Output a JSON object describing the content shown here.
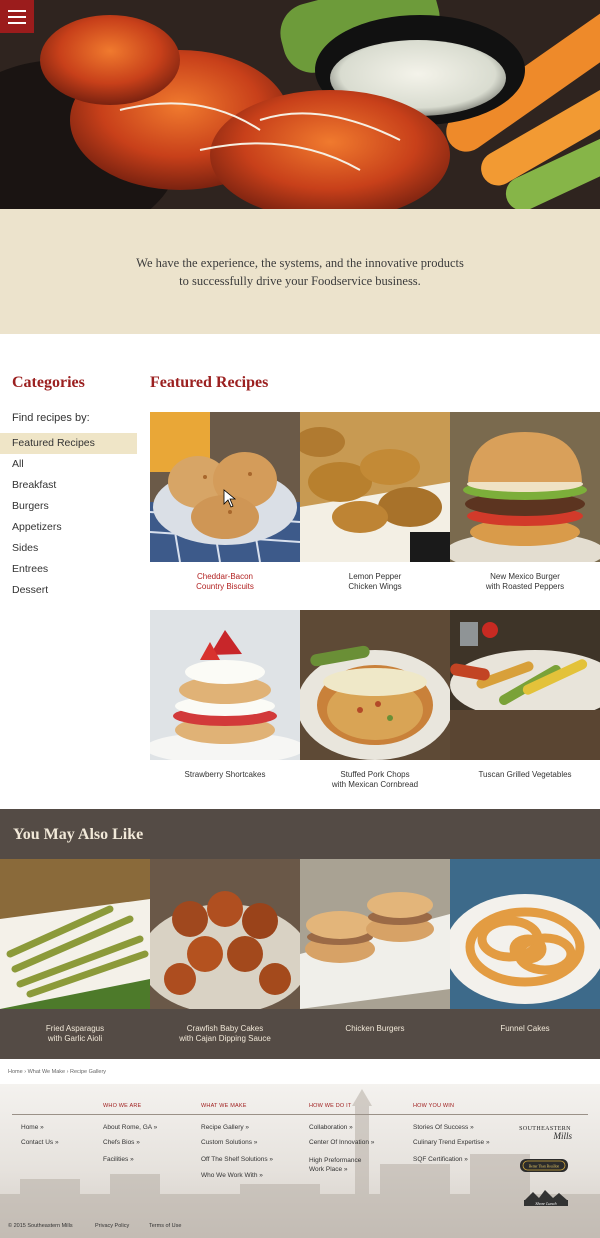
{
  "tagline": {
    "line1": "We have the experience, the systems, and the innovative products",
    "line2": "to successfully drive your Foodservice business."
  },
  "categories": {
    "title": "Categories",
    "find_label": "Find recipes by:",
    "items": [
      "Featured Recipes",
      "All",
      "Breakfast",
      "Burgers",
      "Appetizers",
      "Sides",
      "Entrees",
      "Dessert"
    ],
    "active_index": 0
  },
  "featured": {
    "title": "Featured Recipes",
    "recipes": [
      {
        "caption": "Cheddar-Bacon\nCountry Biscuits"
      },
      {
        "caption": "Lemon Pepper\nChicken Wings"
      },
      {
        "caption": "New Mexico Burger\nwith Roasted Peppers"
      },
      {
        "caption": "Strawberry Shortcakes"
      },
      {
        "caption": "Stuffed Pork Chops\nwith Mexican Cornbread"
      },
      {
        "caption": "Tuscan Grilled Vegetables"
      }
    ]
  },
  "also_like": {
    "title": "You May Also Like",
    "items": [
      {
        "caption": "Fried Asparagus\nwith Garlic Aioli"
      },
      {
        "caption": "Crawfish Baby Cakes\nwith Cajan Dipping Sauce"
      },
      {
        "caption": "Chicken Burgers"
      },
      {
        "caption": "Funnel Cakes"
      }
    ]
  },
  "breadcrumb": {
    "items": [
      "Home",
      "What We Make",
      "Recipe Gallery"
    ],
    "separator": "›"
  },
  "footer": {
    "home_links": [
      "Home »",
      "Contact Us »"
    ],
    "columns": [
      {
        "heading": "WHO WE ARE",
        "links": [
          "About Rome, GA »",
          "Chefs Bios »",
          "Facilities »"
        ]
      },
      {
        "heading": "WHAT WE MAKE",
        "links": [
          "Recipe Gallery »",
          "Custom Solutions »",
          "Off The Shelf Solutions »",
          "Who We Work With »"
        ]
      },
      {
        "heading": "HOW WE DO IT",
        "links": [
          "Collaboration »",
          "Center Of Innovation »",
          "High Preformance\nWork Place »"
        ]
      },
      {
        "heading": "HOW YOU WIN",
        "links": [
          "Stories Of Success »",
          "Culinary Trend Expertise »",
          "SQF Certification »"
        ]
      }
    ],
    "logos": {
      "brand_line1": "SOUTHEASTERN",
      "brand_line2": "Mills",
      "badge": "Better Than Bouillon",
      "shore": "Shore Lunch"
    },
    "copyright": "© 2015 Southeastern Mills",
    "privacy": "Privacy Policy",
    "terms": "Terms of Use"
  },
  "colors": {
    "brand_red": "#9b1c1c",
    "tagline_bg": "#ece3cc",
    "also_bg": "#544b45",
    "active_category_bg": "#efe5c7"
  }
}
